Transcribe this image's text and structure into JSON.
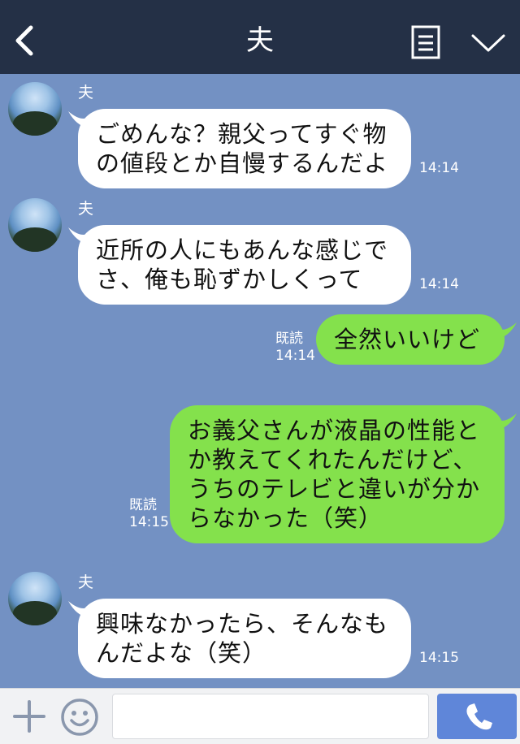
{
  "header": {
    "title": "夫",
    "back_icon": "chevron-left-icon",
    "notes_icon": "note-icon",
    "menu_icon": "chevron-down-icon"
  },
  "colors": {
    "header_bg": "#243046",
    "chat_bg": "#7391c3",
    "incoming_bubble": "#ffffff",
    "outgoing_bubble": "#84e14c",
    "send_button": "#5f86d9"
  },
  "messages": [
    {
      "direction": "incoming",
      "sender": "夫",
      "lines": [
        "ごめんな？親父ってすぐ物",
        "の値段とか自慢するんだよ"
      ],
      "time": "14:14"
    },
    {
      "direction": "incoming",
      "sender": "夫",
      "lines": [
        "近所の人にもあんな感じで",
        "さ、俺も恥ずかしくって"
      ],
      "time": "14:14"
    },
    {
      "direction": "outgoing",
      "read": "既読",
      "lines": [
        "全然いいけど"
      ],
      "time": "14:14"
    },
    {
      "direction": "outgoing",
      "read": "既読",
      "lines": [
        "お義父さんが液晶の性能と",
        "か教えてくれたんだけど、",
        "うちのテレビと違いが分か",
        "らなかった（笑）"
      ],
      "time": "14:15"
    },
    {
      "direction": "incoming",
      "sender": "夫",
      "lines": [
        "興味なかったら、そんなも",
        "んだよな（笑）"
      ],
      "time": "14:15"
    }
  ],
  "footer": {
    "plus_icon": "plus-icon",
    "sticker_icon": "smiley-icon",
    "input_value": "",
    "call_icon": "phone-icon"
  }
}
